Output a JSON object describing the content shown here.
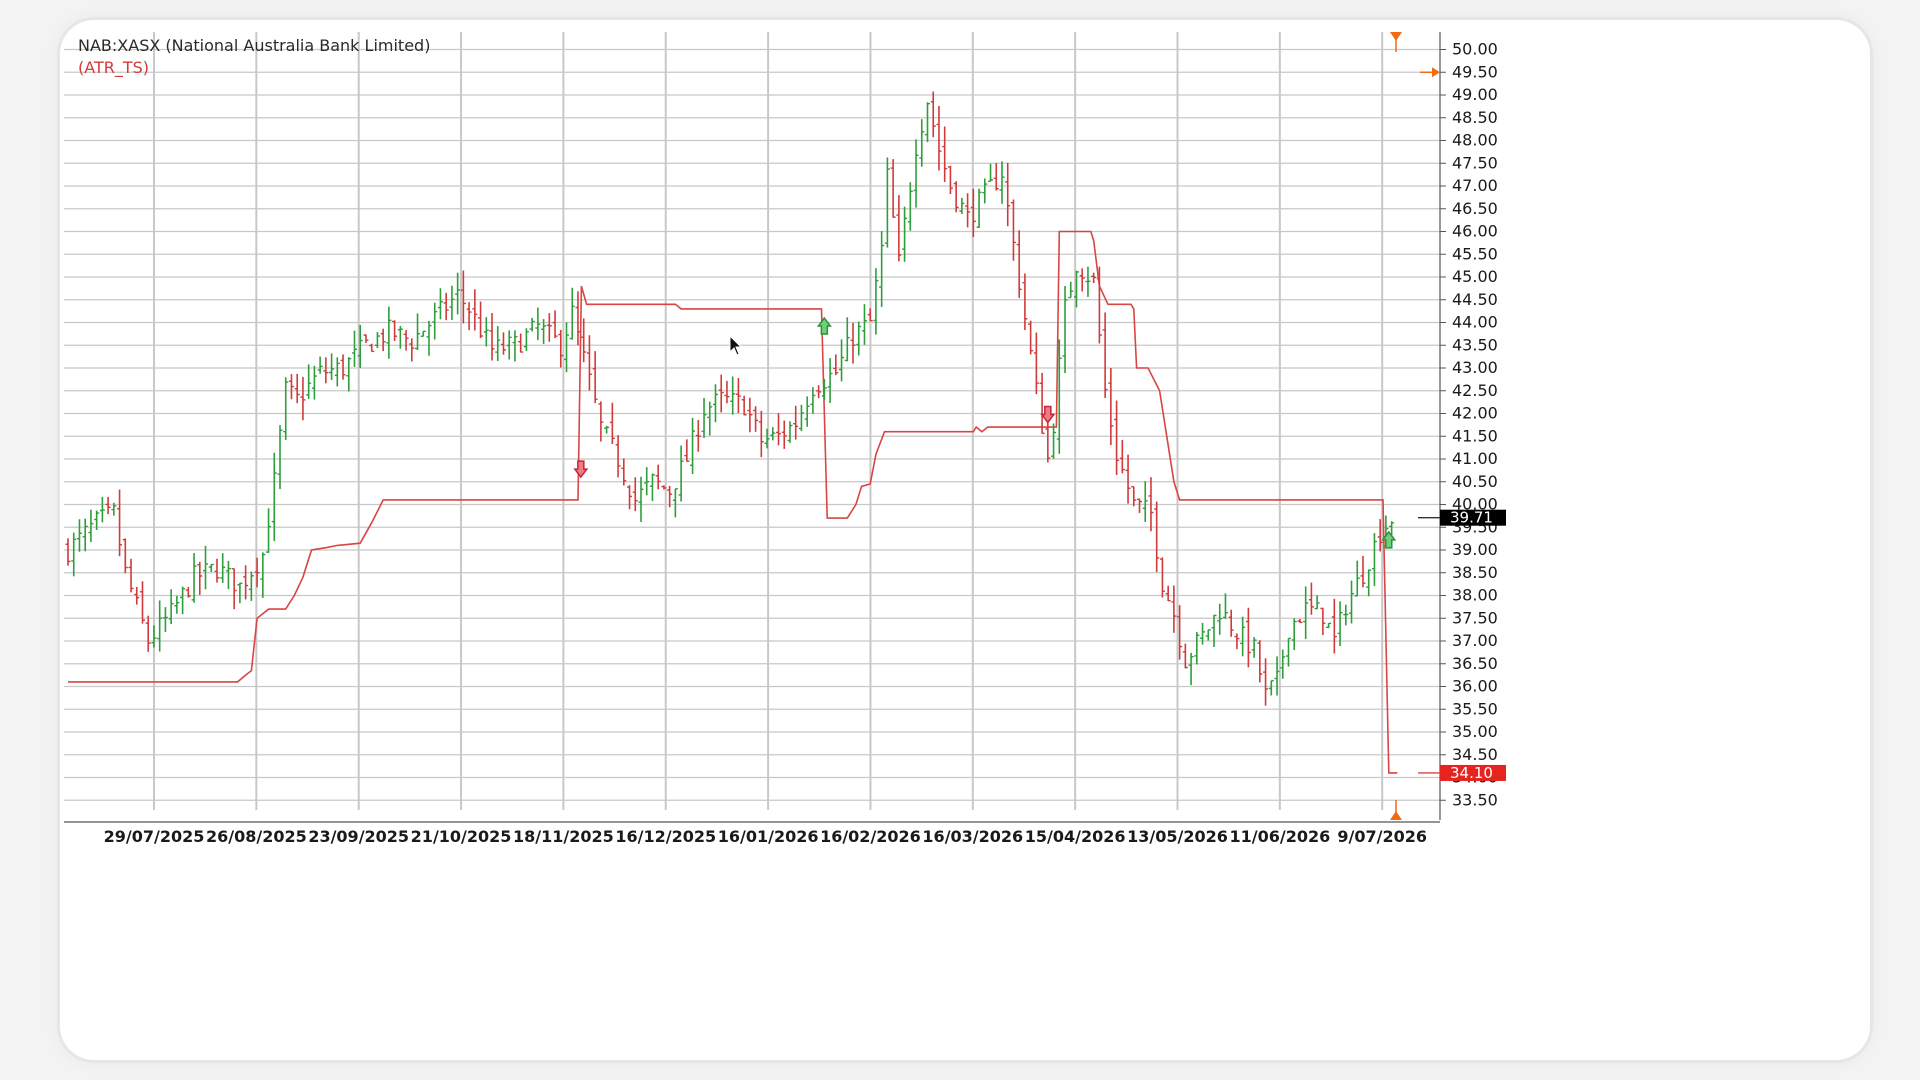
{
  "header": {
    "title": "NAB:XASX (National Australia Bank Limited)",
    "indicator": "(ATR_TS)"
  },
  "colors": {
    "up": "#2e9e3c",
    "down": "#d13a3a",
    "stop_line": "#d94545",
    "grid": "#c8c8c8",
    "last_price_bg": "#000000",
    "stop_price_bg": "#e5231f",
    "marker_arrow": "#f06b13"
  },
  "chart_data": {
    "type": "ohlc",
    "ylim": [
      33.25,
      50.25
    ],
    "y_ticks": [
      "50.00",
      "49.50",
      "49.00",
      "48.50",
      "48.00",
      "47.50",
      "47.00",
      "46.50",
      "46.00",
      "45.50",
      "45.00",
      "44.50",
      "44.00",
      "43.50",
      "43.00",
      "42.50",
      "42.00",
      "41.50",
      "41.00",
      "40.50",
      "40.00",
      "39.50",
      "39.00",
      "38.50",
      "38.00",
      "37.50",
      "37.00",
      "36.50",
      "36.00",
      "35.50",
      "35.00",
      "34.50",
      "34.00",
      "33.50"
    ],
    "x_ticks": [
      "29/07/2025",
      "26/08/2025",
      "23/09/2025",
      "21/10/2025",
      "18/11/2025",
      "16/12/2025",
      "16/01/2026",
      "16/02/2026",
      "16/03/2026",
      "15/04/2026",
      "13/05/2026",
      "11/06/2026",
      "9/07/2026"
    ],
    "close_path": [
      [
        0,
        39.0
      ],
      [
        5,
        39.6
      ],
      [
        8,
        39.8
      ],
      [
        10,
        38.5
      ],
      [
        14,
        37.0
      ],
      [
        18,
        37.6
      ],
      [
        22,
        38.4
      ],
      [
        26,
        38.6
      ],
      [
        30,
        38.2
      ],
      [
        34,
        38.9
      ],
      [
        36,
        40.5
      ],
      [
        38,
        42.5
      ],
      [
        40,
        42.3
      ],
      [
        44,
        42.9
      ],
      [
        48,
        43.0
      ],
      [
        52,
        43.5
      ],
      [
        56,
        43.8
      ],
      [
        60,
        43.6
      ],
      [
        64,
        44.1
      ],
      [
        68,
        44.6
      ],
      [
        70,
        44.3
      ],
      [
        74,
        43.4
      ],
      [
        78,
        43.5
      ],
      [
        82,
        43.9
      ],
      [
        86,
        43.5
      ],
      [
        88,
        44.2
      ],
      [
        90,
        43.2
      ],
      [
        93,
        41.7
      ],
      [
        96,
        41.0
      ],
      [
        99,
        40.1
      ],
      [
        102,
        40.5
      ],
      [
        105,
        40.3
      ],
      [
        108,
        41.0
      ],
      [
        111,
        42.1
      ],
      [
        114,
        42.3
      ],
      [
        118,
        42.2
      ],
      [
        121,
        41.4
      ],
      [
        124,
        41.5
      ],
      [
        127,
        41.8
      ],
      [
        130,
        42.6
      ],
      [
        134,
        42.9
      ],
      [
        137,
        43.7
      ],
      [
        140,
        44.0
      ],
      [
        142,
        45.6
      ],
      [
        143,
        47.2
      ],
      [
        145,
        45.3
      ],
      [
        148,
        47.9
      ],
      [
        150,
        48.9
      ],
      [
        152,
        47.8
      ],
      [
        154,
        47.0
      ],
      [
        157,
        46.3
      ],
      [
        160,
        46.8
      ],
      [
        163,
        47.3
      ],
      [
        166,
        44.9
      ],
      [
        169,
        42.5
      ],
      [
        171,
        41.0
      ],
      [
        172,
        41.8
      ],
      [
        174,
        44.3
      ],
      [
        176,
        45.3
      ],
      [
        179,
        44.9
      ],
      [
        181,
        42.5
      ],
      [
        183,
        41.1
      ],
      [
        186,
        40.0
      ],
      [
        189,
        39.8
      ],
      [
        191,
        38.3
      ],
      [
        193,
        37.6
      ],
      [
        195,
        36.6
      ],
      [
        198,
        37.1
      ],
      [
        201,
        37.7
      ],
      [
        204,
        37.2
      ],
      [
        207,
        36.8
      ],
      [
        209,
        35.8
      ],
      [
        211,
        36.1
      ],
      [
        213,
        37.3
      ],
      [
        216,
        37.7
      ],
      [
        219,
        37.6
      ],
      [
        221,
        37.0
      ],
      [
        223,
        37.8
      ],
      [
        226,
        38.5
      ],
      [
        229,
        39.4
      ],
      [
        231,
        39.7
      ]
    ],
    "stop_line": [
      [
        0,
        36.1
      ],
      [
        29.6,
        36.1
      ],
      [
        31,
        36.25
      ],
      [
        32,
        36.35
      ],
      [
        33,
        37.5
      ],
      [
        35,
        37.7
      ],
      [
        38,
        37.7
      ],
      [
        39.5,
        38.0
      ],
      [
        41,
        38.4
      ],
      [
        42.5,
        39.0
      ],
      [
        45,
        39.05
      ],
      [
        47,
        39.1
      ],
      [
        51,
        39.15
      ],
      [
        53,
        39.6
      ],
      [
        55,
        40.1
      ],
      [
        85,
        40.1
      ],
      [
        89,
        40.1
      ],
      [
        89.6,
        44.8
      ],
      [
        90.5,
        44.4
      ],
      [
        106,
        44.4
      ],
      [
        107,
        44.3
      ],
      [
        131.5,
        44.3
      ],
      [
        132.5,
        39.7
      ],
      [
        136,
        39.7
      ],
      [
        137.5,
        40.0
      ],
      [
        138.5,
        40.4
      ],
      [
        140,
        40.45
      ],
      [
        141,
        41.1
      ],
      [
        142.5,
        41.6
      ],
      [
        158,
        41.6
      ],
      [
        158.5,
        41.7
      ],
      [
        159.5,
        41.6
      ],
      [
        160.5,
        41.7
      ],
      [
        172.5,
        41.7
      ],
      [
        173,
        46.0
      ],
      [
        178.5,
        46.0
      ],
      [
        179,
        45.8
      ],
      [
        180,
        44.8
      ],
      [
        181.5,
        44.4
      ],
      [
        185.5,
        44.4
      ],
      [
        186,
        44.3
      ],
      [
        186.5,
        43.0
      ],
      [
        188.5,
        43.0
      ],
      [
        190.5,
        42.5
      ],
      [
        193,
        40.5
      ],
      [
        194,
        40.1
      ],
      [
        229.5,
        40.1
      ],
      [
        230.5,
        34.1
      ],
      [
        232,
        34.1
      ]
    ],
    "signals": [
      {
        "type": "sell",
        "x": 89.5,
        "y": 40.8
      },
      {
        "type": "buy",
        "x": 132,
        "y": 43.9
      },
      {
        "type": "sell",
        "x": 171,
        "y": 42.0
      },
      {
        "type": "buy",
        "x": 230.5,
        "y": 39.2
      }
    ],
    "last_price": "39.71",
    "stop_price": "34.10"
  }
}
